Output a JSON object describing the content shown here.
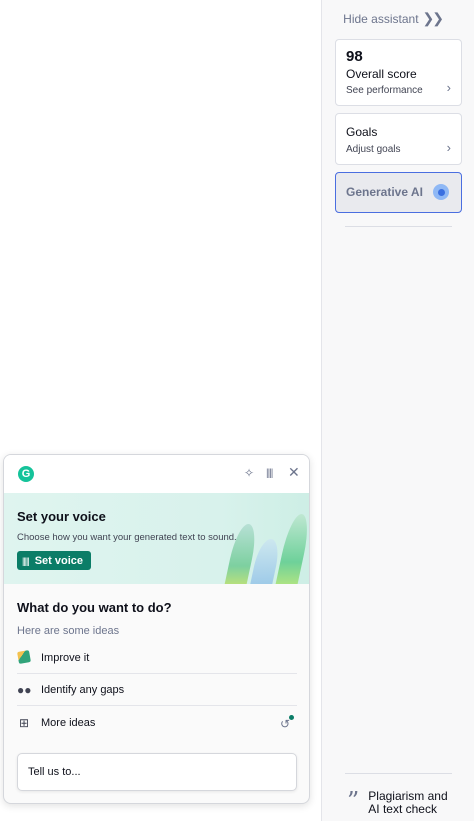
{
  "sidebar": {
    "hide_assistant": "Hide assistant",
    "score": {
      "value": "98",
      "title": "Overall score",
      "link": "See performance"
    },
    "goals": {
      "title": "Goals",
      "link": "Adjust goals"
    },
    "generative_ai": {
      "title": "Generative AI"
    },
    "plagiarism": {
      "line1": "Plagiarism and",
      "line2": "AI text check"
    }
  },
  "popup": {
    "voice": {
      "title": "Set your voice",
      "subtitle": "Choose how you want your generated text to sound.",
      "button": "Set voice"
    },
    "ask_title": "What do you want to do?",
    "ideas_label": "Here are some ideas",
    "ideas": [
      {
        "label": "Improve it",
        "icon": "pencil-sparkle-icon"
      },
      {
        "label": "Identify any gaps",
        "icon": "binoculars-icon"
      },
      {
        "label": "More ideas",
        "icon": "grid-plus-icon"
      }
    ],
    "prompt_placeholder": "Tell us to..."
  },
  "colors": {
    "accent_green": "#0b7d67",
    "brand_green": "#15c39a",
    "focus_blue": "#4a6ee0",
    "banner_bg": "#dff4ef"
  }
}
